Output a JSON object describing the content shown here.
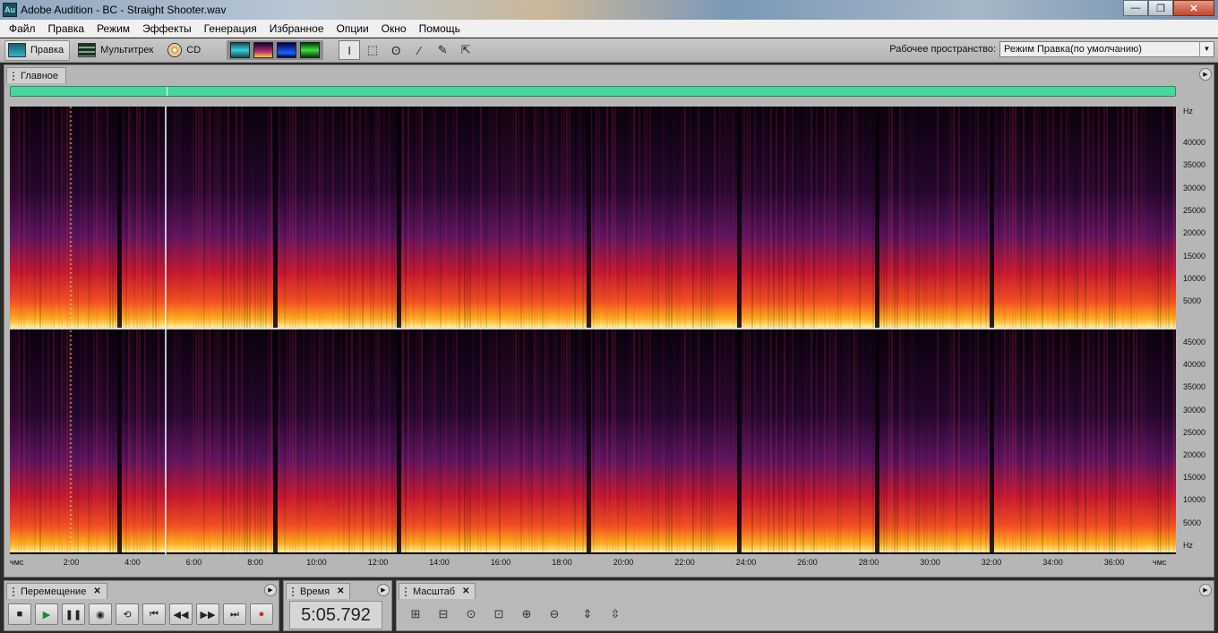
{
  "window": {
    "app_icon": "Au",
    "title": "Adobe Audition - BC - Straight Shooter.wav",
    "minimize": "—",
    "maximize": "❐",
    "close": "✕"
  },
  "menu": [
    "Файл",
    "Правка",
    "Режим",
    "Эффекты",
    "Генерация",
    "Избранное",
    "Опции",
    "Окно",
    "Помощь"
  ],
  "toolbar": {
    "modes": [
      {
        "label": "Правка",
        "icon": "edit-view-icon",
        "active": true
      },
      {
        "label": "Мультитрек",
        "icon": "multitrack-icon",
        "active": false
      },
      {
        "label": "CD",
        "icon": "cd-icon",
        "active": false
      }
    ],
    "view_buttons": [
      "waveform-view-icon",
      "spectral-view-icon",
      "pan-view-icon",
      "phase-view-icon"
    ],
    "tools": [
      {
        "icon": "time-selection-icon",
        "glyph": "I",
        "active": true
      },
      {
        "icon": "marquee-icon",
        "glyph": "⬚",
        "active": false
      },
      {
        "icon": "lasso-icon",
        "glyph": "ʘ",
        "active": false
      },
      {
        "icon": "brush-icon",
        "glyph": "⁄",
        "active": false
      },
      {
        "icon": "healing-icon",
        "glyph": "✎",
        "active": false
      },
      {
        "icon": "scrub-icon",
        "glyph": "⇱",
        "active": false
      }
    ],
    "workspace_label": "Рабочее пространство:",
    "workspace_value": "Режим Правка(по умолчанию)"
  },
  "main_panel": {
    "tab_label": "Главное"
  },
  "spectrogram": {
    "top_channel_ticks": [
      "Hz",
      "40000",
      "35000",
      "30000",
      "25000",
      "20000",
      "15000",
      "10000",
      "5000"
    ],
    "bottom_channel_ticks": [
      "45000",
      "40000",
      "35000",
      "30000",
      "25000",
      "20000",
      "15000",
      "10000",
      "5000",
      "Hz"
    ],
    "time_ticks": [
      "чмс",
      "2:00",
      "4:00",
      "6:00",
      "8:00",
      "10:00",
      "12:00",
      "14:00",
      "16:00",
      "18:00",
      "20:00",
      "22:00",
      "24:00",
      "26:00",
      "28:00",
      "30:00",
      "32:00",
      "34:00",
      "36:00",
      "чмс"
    ]
  },
  "transport": {
    "tab_label": "Перемещение",
    "buttons": [
      {
        "name": "stop-button",
        "glyph": "■"
      },
      {
        "name": "play-button",
        "glyph": "▶"
      },
      {
        "name": "pause-button",
        "glyph": "❚❚"
      },
      {
        "name": "play-from-cursor-button",
        "glyph": "◉"
      },
      {
        "name": "loop-button",
        "glyph": "⟲"
      },
      {
        "name": "go-to-start-button",
        "glyph": "⏮"
      },
      {
        "name": "rewind-button",
        "glyph": "◀◀"
      },
      {
        "name": "fast-forward-button",
        "glyph": "▶▶"
      },
      {
        "name": "go-to-end-button",
        "glyph": "⏭"
      },
      {
        "name": "record-button",
        "glyph": "●"
      }
    ]
  },
  "time": {
    "tab_label": "Время",
    "value": "5:05.792"
  },
  "zoom": {
    "tab_label": "Масштаб",
    "buttons": [
      "zoom-in-amplitude-icon",
      "zoom-out-amplitude-icon",
      "zoom-out-full-icon",
      "zoom-to-selection-icon",
      "zoom-in-left-icon",
      "zoom-in-right-icon",
      "zoom-in-vertical-icon",
      "zoom-out-vertical-icon"
    ]
  },
  "colors": {
    "overview": "#48d89c",
    "spectrogram_low": "#fff4a0",
    "spectrogram_mid": "#e0301e",
    "spectrogram_high": "#3a0a4a"
  }
}
